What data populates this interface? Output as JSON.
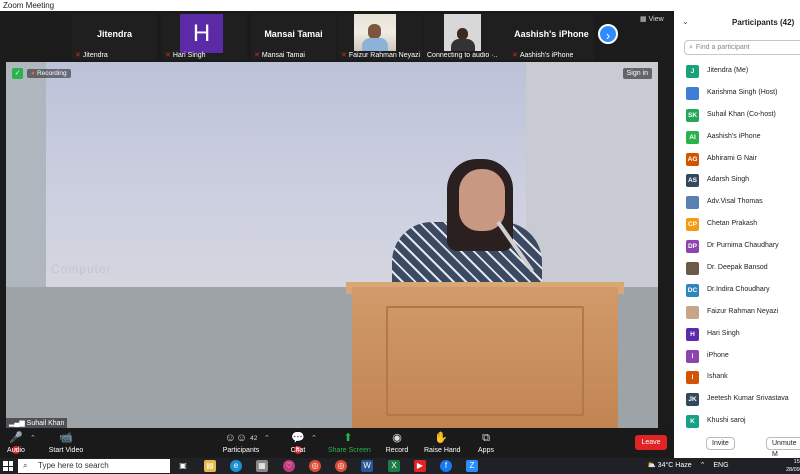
{
  "window": {
    "title": "Zoom Meeting"
  },
  "strip": {
    "tiles": [
      {
        "name": "Jitendra",
        "label": "Jitendra"
      },
      {
        "avatar_letter": "H",
        "label": "Hari Singh",
        "avatar_color": "#5b2aa6"
      },
      {
        "name": "Mansai Tamai",
        "label": "Mansai Tamai"
      },
      {
        "label": "Faizur Rahman Neyazi"
      },
      {
        "label": "Connecting to audio ·.."
      },
      {
        "name": "Aashish's iPhone",
        "label": "Aashish's iPhone"
      }
    ],
    "next_icon": "chevron-right-icon",
    "view_label": "View"
  },
  "video": {
    "recording_label": "Recording",
    "signin_label": "Sign in",
    "speaker_name": "Suhail Khan",
    "screen_text": "Computer"
  },
  "toolbar": {
    "audio": "Audio",
    "start_video": "Start Video",
    "participants": "Participants",
    "participants_count": "42",
    "chat": "Chat",
    "chat_badge": "8",
    "share_screen": "Share Screen",
    "record": "Record",
    "raise_hand": "Raise Hand",
    "apps": "Apps",
    "leave": "Leave"
  },
  "panel": {
    "title": "Participants (42)",
    "search_placeholder": "Find a participant",
    "participants": [
      {
        "initials": "J",
        "name": "Jitendra (Me)",
        "color": "#1aa37a"
      },
      {
        "initials": "",
        "name": "Karishma Singh (Host)",
        "color": "#3d7fd6"
      },
      {
        "initials": "SK",
        "name": "Suhail Khan (Co-host)",
        "color": "#26a65b"
      },
      {
        "initials": "AI",
        "name": "Aashish's iPhone",
        "color": "#2bb24c"
      },
      {
        "initials": "AG",
        "name": "Abhirami G Nair",
        "color": "#d35400"
      },
      {
        "initials": "AS",
        "name": "Adarsh Singh",
        "color": "#34495e"
      },
      {
        "initials": "",
        "name": "Adv.Visal Thomas",
        "color": "#5a7fb0"
      },
      {
        "initials": "CP",
        "name": "Chetan Prakash",
        "color": "#f39c12"
      },
      {
        "initials": "DP",
        "name": "Dr Purnima Chaudhary",
        "color": "#8e44ad"
      },
      {
        "initials": "",
        "name": "Dr. Deepak Bansod",
        "color": "#6b5a4a"
      },
      {
        "initials": "DC",
        "name": "Dr.Indira  Choudhary",
        "color": "#2e86c1"
      },
      {
        "initials": "",
        "name": "Faizur Rahman Neyazi",
        "color": "#c8a58a"
      },
      {
        "initials": "H",
        "name": "Hari Singh",
        "color": "#5b2aa6"
      },
      {
        "initials": "I",
        "name": "iPhone",
        "color": "#8e44ad"
      },
      {
        "initials": "I",
        "name": "Ishank",
        "color": "#d35400"
      },
      {
        "initials": "JK",
        "name": "Jeetesh Kumar Srivastava",
        "color": "#34495e"
      },
      {
        "initials": "K",
        "name": "Khushi saroj",
        "color": "#16a085"
      }
    ],
    "invite_label": "Invite",
    "mute_label": "Unmute M"
  },
  "taskbar": {
    "search_placeholder": "Type here to search",
    "weather": "34°C  Haze",
    "lang": "ENG",
    "time": "15",
    "date": "28/09"
  }
}
